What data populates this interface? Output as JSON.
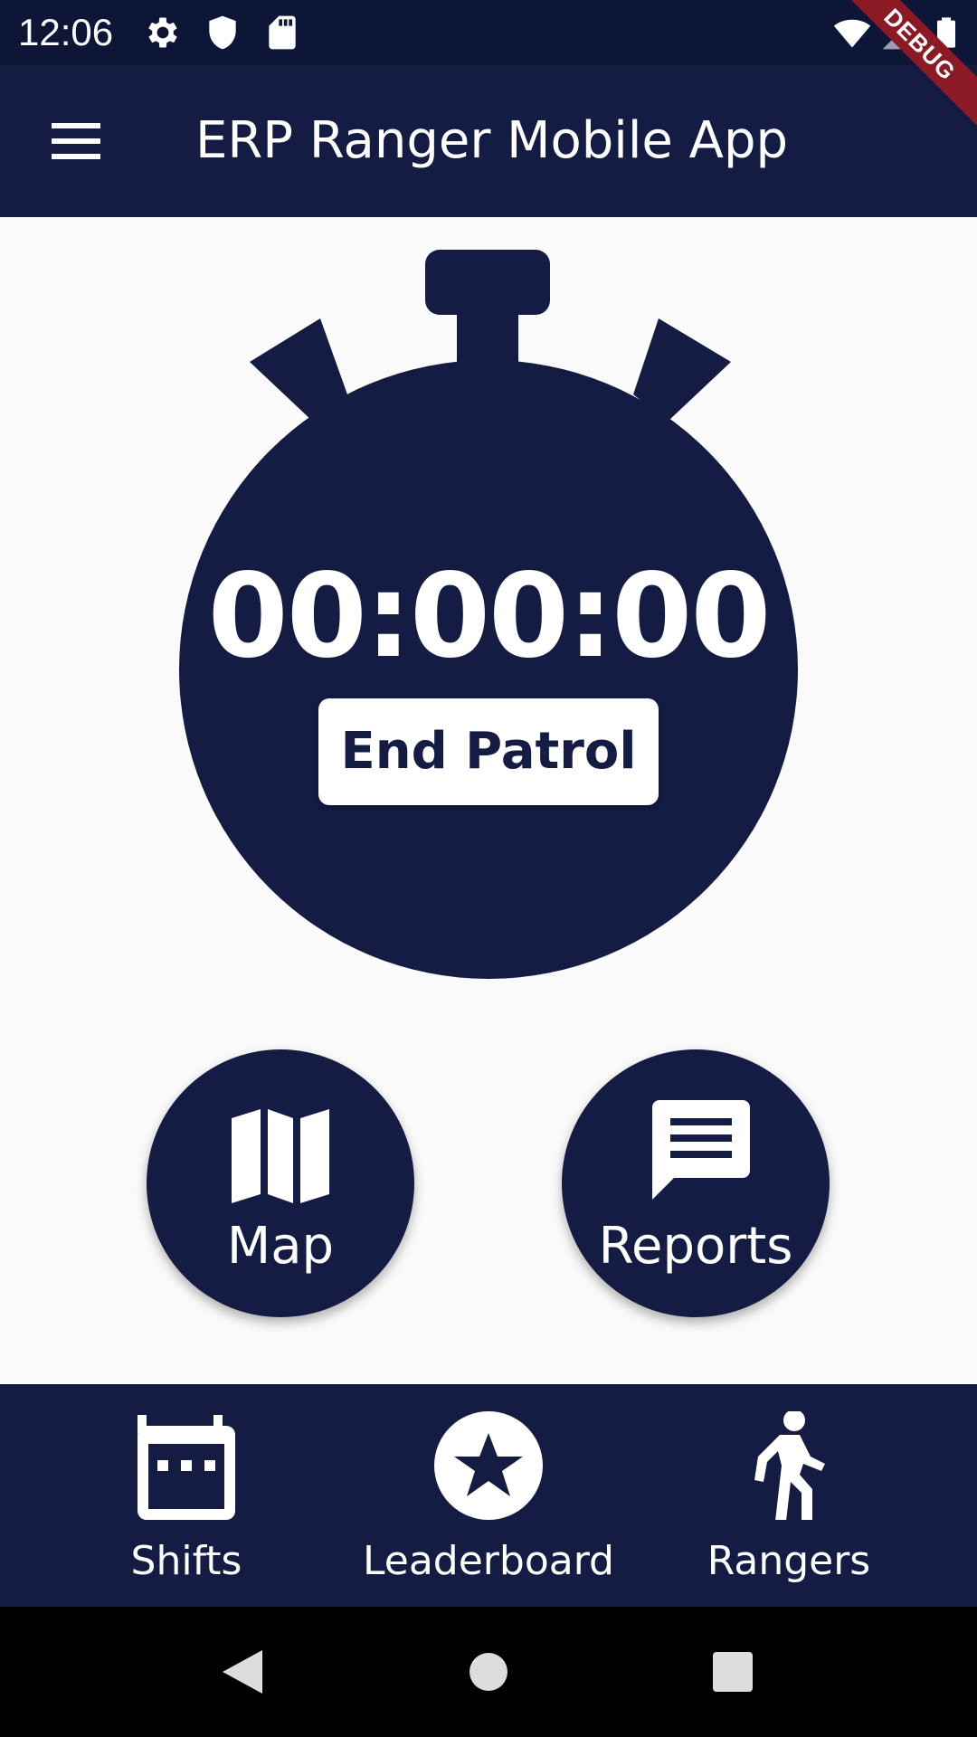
{
  "status_bar": {
    "time": "12:06",
    "left_icons": [
      "settings-icon",
      "shield-icon",
      "sd-card-icon"
    ],
    "right_icons": [
      "wifi-icon",
      "cell-signal-icon",
      "battery-icon"
    ]
  },
  "debug_banner": "DEBUG",
  "app_bar": {
    "title": "ERP Ranger Mobile App",
    "menu_icon": "menu-icon"
  },
  "stopwatch": {
    "time": "00:00:00",
    "end_button_label": "End Patrol"
  },
  "actions": {
    "map_label": "Map",
    "map_icon": "map-icon",
    "reports_label": "Reports",
    "reports_icon": "chat-icon"
  },
  "bottom_nav": {
    "items": [
      {
        "label": "Shifts",
        "icon": "calendar-icon"
      },
      {
        "label": "Leaderboard",
        "icon": "star-circle-icon"
      },
      {
        "label": "Rangers",
        "icon": "walking-person-icon"
      }
    ]
  },
  "colors": {
    "primary": "#141c44",
    "status_bar": "#0e1637",
    "background": "#fafafa",
    "debug_banner": "#8b1a24"
  }
}
